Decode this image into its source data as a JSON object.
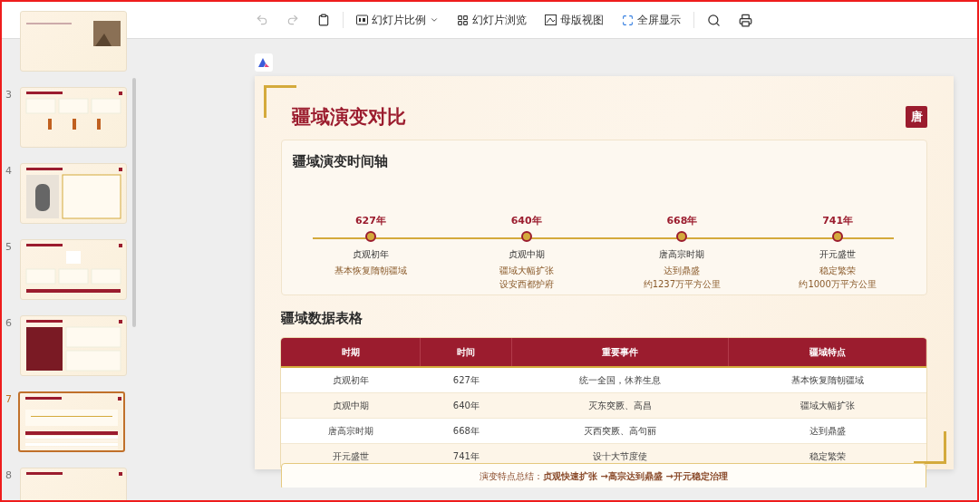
{
  "toolbar": {
    "undo": {
      "disabled": true
    },
    "redo": {
      "disabled": true
    },
    "items": [
      {
        "kind": "ratio",
        "label": "幻灯片比例"
      },
      {
        "kind": "grid",
        "label": "幻灯片浏览"
      },
      {
        "kind": "master",
        "label": "母版视图"
      },
      {
        "kind": "fullscreen",
        "label": "全屏显示"
      }
    ]
  },
  "thumbnails": [
    {
      "kind": "image",
      "selected": false
    },
    {
      "number": "3",
      "kind": "bars",
      "selected": false
    },
    {
      "number": "4",
      "kind": "figure",
      "selected": false
    },
    {
      "number": "5",
      "kind": "flow",
      "selected": false
    },
    {
      "number": "6",
      "kind": "panel",
      "selected": false
    },
    {
      "number": "7",
      "kind": "table",
      "selected": true
    },
    {
      "number": "8",
      "kind": "header",
      "selected": false
    }
  ],
  "slide": {
    "title": "疆域演变对比",
    "badge": "唐",
    "timeline": {
      "heading": "疆域演变时间轴",
      "events": [
        {
          "year": "627年",
          "name": "贞观初年",
          "lines": [
            "基本恢复隋朝疆域"
          ]
        },
        {
          "year": "640年",
          "name": "贞观中期",
          "lines": [
            "疆域大幅扩张",
            "设安西都护府"
          ]
        },
        {
          "year": "668年",
          "name": "唐高宗时期",
          "lines": [
            "达到鼎盛",
            "约1237万平方公里"
          ]
        },
        {
          "year": "741年",
          "name": "开元盛世",
          "lines": [
            "稳定繁荣",
            "约1000万平方公里"
          ]
        }
      ]
    },
    "table": {
      "heading": "疆域数据表格",
      "columns": [
        "时期",
        "时间",
        "重要事件",
        "疆域特点"
      ],
      "rows": [
        [
          "贞观初年",
          "627年",
          "统一全国，休养生息",
          "基本恢复隋朝疆域"
        ],
        [
          "贞观中期",
          "640年",
          "灭东突厥、高昌",
          "疆域大幅扩张"
        ],
        [
          "唐高宗时期",
          "668年",
          "灭西突厥、高句丽",
          "达到鼎盛"
        ],
        [
          "开元盛世",
          "741年",
          "设十大节度使",
          "稳定繁荣"
        ]
      ]
    },
    "summary": "演变特点总结：**贞观快速扩张 →高宗达到鼎盛 →开元稳定治理**"
  }
}
